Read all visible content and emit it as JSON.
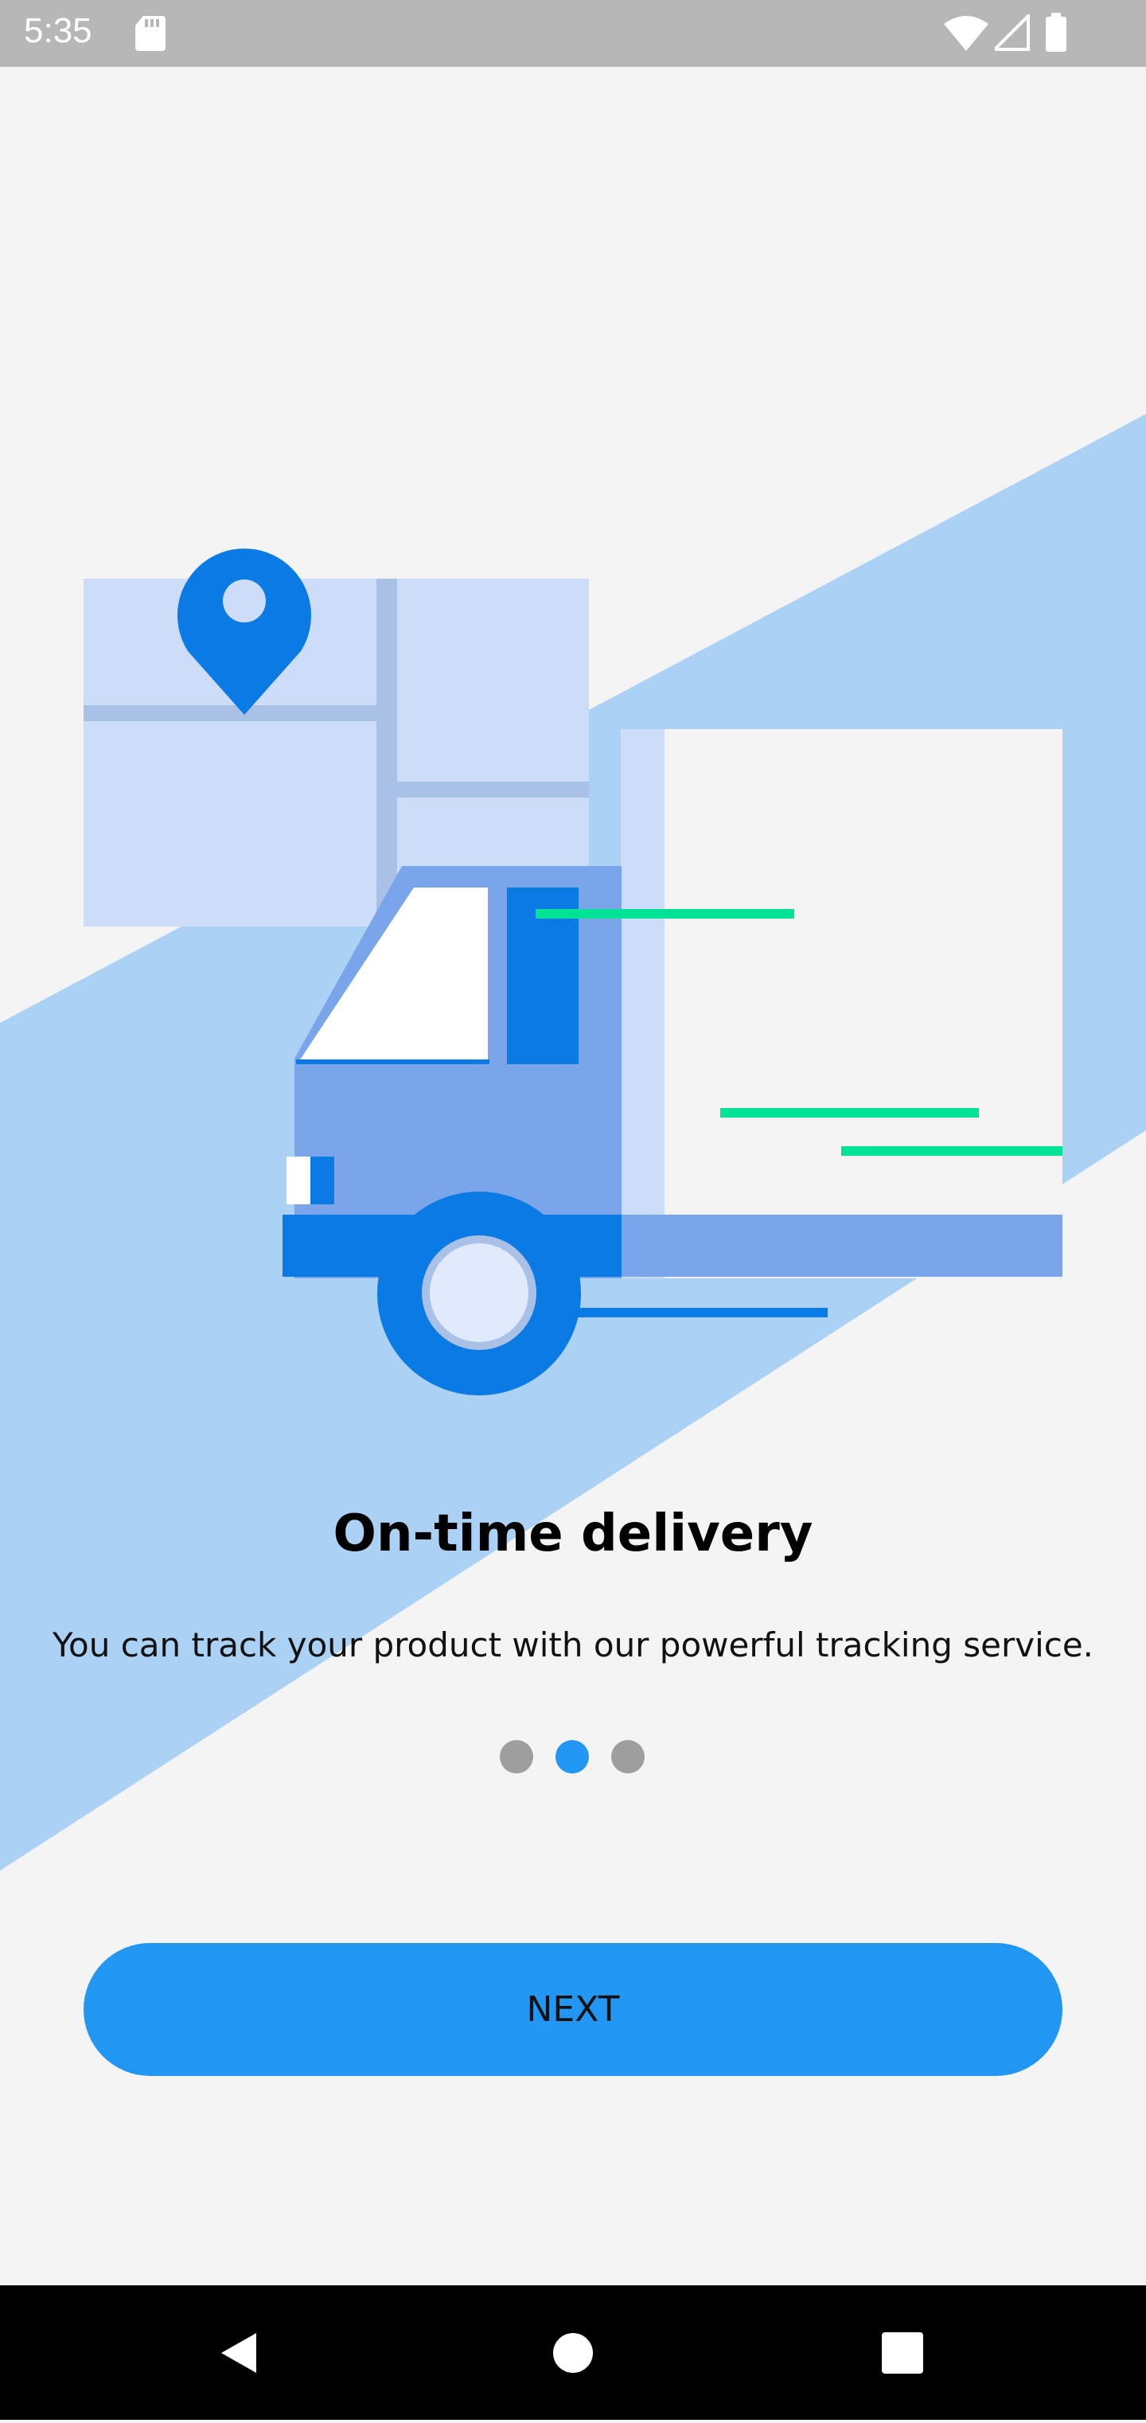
{
  "status_bar": {
    "time": "5:35",
    "icons": [
      "sd-card-icon",
      "wifi-icon",
      "signal-icon",
      "battery-icon"
    ]
  },
  "onboarding": {
    "title": "On-time delivery",
    "subtitle": "You can track your product with our powerful tracking service.",
    "page_indicator": {
      "total": 3,
      "active_index": 1
    },
    "next_label": "NEXT"
  },
  "navigation_bar": {
    "buttons": [
      "back-icon",
      "home-icon",
      "recents-icon"
    ]
  },
  "colors": {
    "accent": "#2196f3",
    "illustration_blue": "#0a7be4",
    "light_blue": "#abd1f5",
    "green": "#00e396",
    "status_bar": "#b7b7b7",
    "nav_bar": "#000000"
  }
}
